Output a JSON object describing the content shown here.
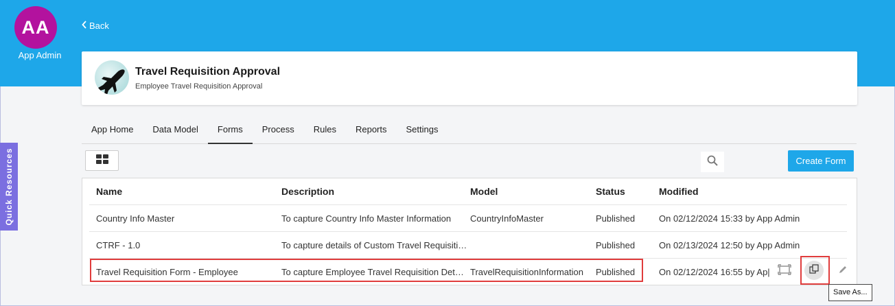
{
  "user": {
    "initials": "AA",
    "name": "App Admin"
  },
  "nav": {
    "back_label": "Back"
  },
  "app": {
    "title": "Travel Requisition Approval",
    "subtitle": "Employee Travel Requisition Approval"
  },
  "tabs": [
    {
      "label": "App Home"
    },
    {
      "label": "Data Model"
    },
    {
      "label": "Forms",
      "active": true
    },
    {
      "label": "Process"
    },
    {
      "label": "Rules"
    },
    {
      "label": "Reports"
    },
    {
      "label": "Settings"
    }
  ],
  "toolbar": {
    "view_icon": "grid-view-icon",
    "search_icon": "search-icon",
    "create_label": "Create Form"
  },
  "table": {
    "columns": [
      "Name",
      "Description",
      "Model",
      "Status",
      "Modified"
    ],
    "rows": [
      {
        "name": "Country Info Master",
        "description": "To capture Country Info Master Information",
        "model": "CountryInfoMaster",
        "status": "Published",
        "modified": "On 02/12/2024 15:33 by App Admin"
      },
      {
        "name": "CTRF - 1.0",
        "description": "To capture details of Custom Travel Requisiti…",
        "model": "",
        "status": "Published",
        "modified": "On 02/13/2024 12:50 by App Admin"
      },
      {
        "name": "Travel Requisition Form - Employee",
        "description": "To capture Employee Travel Requisition Detai…",
        "model": "TravelRequisitionInformation",
        "status": "Published",
        "modified": "On 02/12/2024 16:55 by Ap|"
      }
    ]
  },
  "row_actions": {
    "icons": [
      "preview-icon",
      "save-as-icon",
      "edit-icon"
    ]
  },
  "tooltip": "Save As...",
  "quick_resources": "Quick Resources",
  "colors": {
    "brand_blue": "#1ea7e9",
    "avatar": "#b3129e",
    "quick_resources": "#7b6fe0",
    "highlight": "#e03c3c"
  }
}
